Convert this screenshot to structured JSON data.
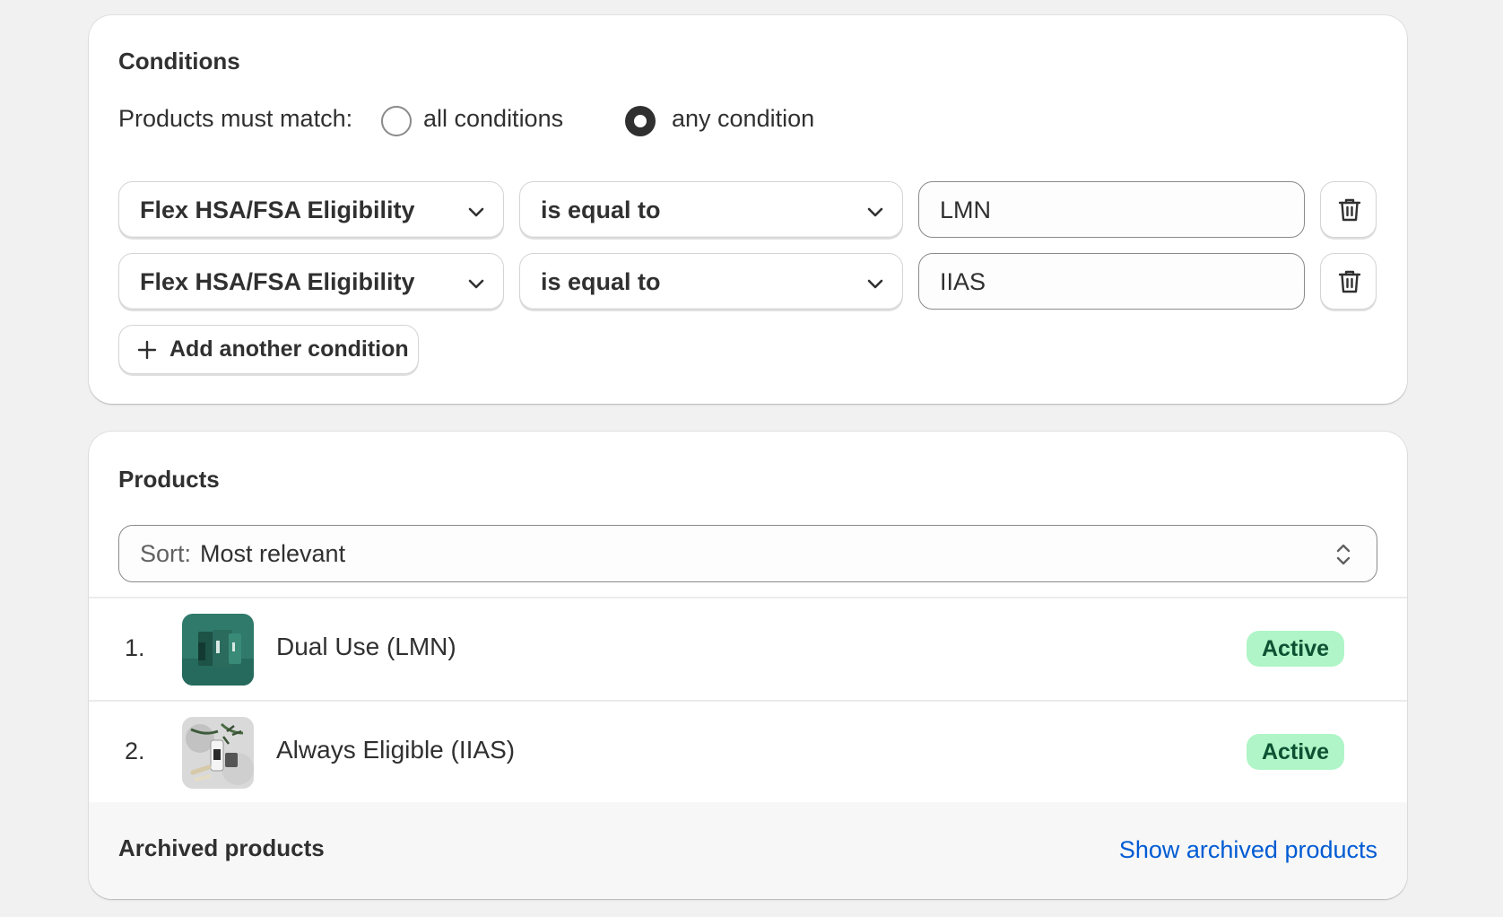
{
  "conditions": {
    "title": "Conditions",
    "match_label": "Products must match:",
    "options": [
      {
        "label": "all conditions",
        "selected": false
      },
      {
        "label": "any condition",
        "selected": true
      }
    ],
    "rows": [
      {
        "field": "Flex HSA/FSA Eligibility",
        "operator": "is equal to",
        "value": "LMN",
        "delete_icon": "trash-icon"
      },
      {
        "field": "Flex HSA/FSA Eligibility",
        "operator": "is equal to",
        "value": "IIAS",
        "delete_icon": "trash-icon"
      }
    ],
    "add_button": "Add another condition"
  },
  "products": {
    "title": "Products",
    "sort_prefix": "Sort:",
    "sort_value": "Most relevant",
    "items": [
      {
        "index": "1.",
        "name": "Dual Use (LMN)",
        "status": "Active"
      },
      {
        "index": "2.",
        "name": "Always Eligible (IIAS)",
        "status": "Active"
      }
    ],
    "archived_title": "Archived products",
    "archived_link": "Show archived products"
  },
  "colors": {
    "page_bg": "#f1f1f1",
    "text": "#303030",
    "badge_bg": "#aff5c7",
    "badge_text": "#0c5132",
    "link": "#005bd3"
  }
}
